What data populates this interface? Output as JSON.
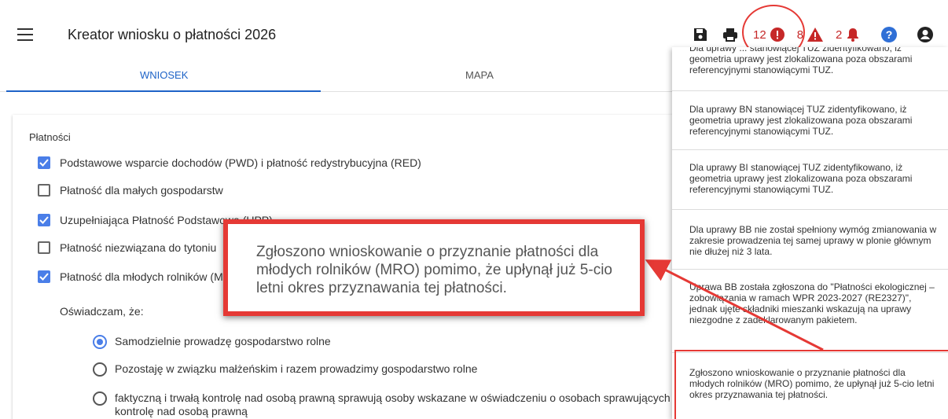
{
  "app": {
    "title": "Kreator wniosku o płatności 2026"
  },
  "toolbar": {
    "errors_count": "12",
    "warnings_count": "8",
    "notifications_count": "2",
    "accent_color": "#c62828"
  },
  "tabs": [
    {
      "label": "WNIOSEK",
      "active": true
    },
    {
      "label": "MAPA",
      "active": false
    }
  ],
  "payments": {
    "section_label": "Płatności",
    "items": [
      {
        "label": "Podstawowe wsparcie dochodów (PWD) i płatność redystrybucyjna (RED)",
        "checked": true
      },
      {
        "label": "Płatność dla małych gospodarstw",
        "checked": false
      },
      {
        "label": "Uzupełniająca Płatność Podstawowa (UPP)",
        "checked": true
      },
      {
        "label": "Płatność niezwiązana do tytoniu",
        "checked": false
      },
      {
        "label": "Płatność dla młodych rolników (MRO)",
        "checked": true
      }
    ],
    "declaration_label": "Oświadczam, że:",
    "radios": [
      {
        "label": "Samodzielnie prowadzę gospodarstwo rolne",
        "checked": true
      },
      {
        "label": "Pozostaję w związku małżeńskim i razem prowadzimy gospodarstwo rolne",
        "checked": false
      },
      {
        "label": "faktyczną i trwałą kontrolę nad osobą prawną sprawują osoby wskazane w oświadczeniu o osobach sprawujących kontrolę nad osobą prawną",
        "checked": false
      }
    ]
  },
  "notifications": [
    {
      "text": "Dla uprawy ... stanowiącej TUZ zidentyfikowano, iż geometria uprawy jest zlokalizowana poza obszarami referencyjnymi stanowiącymi TUZ."
    },
    {
      "text": "Dla uprawy BN stanowiącej TUZ zidentyfikowano, iż geometria uprawy jest zlokalizowana poza obszarami referencyjnymi stanowiącymi TUZ."
    },
    {
      "text": "Dla uprawy BI stanowiącej TUZ zidentyfikowano, iż geometria uprawy jest zlokalizowana poza obszarami referencyjnymi stanowiącymi TUZ."
    },
    {
      "text": "Dla uprawy BB nie został spełniony wymóg zmianowania w zakresie prowadzenia tej samej uprawy w plonie głównym nie dłużej niż 3 lata."
    },
    {
      "text": "Uprawa BB została zgłoszona do \"Płatności ekologicznej – zobowiązania w ramach WPR 2023-2027 (RE2327)\", jednak ujęte składniki mieszanki wskazują na uprawy niezgodne z zadeklarowanym pakietem."
    },
    {
      "text": "Zgłoszono wnioskowanie o przyznanie płatności dla młodych rolników (MRO) pomimo, że upłynął już 5-cio letni okres przyznawania tej płatności."
    }
  ],
  "callout": {
    "text": "Zgłoszono wnioskowanie o przyznanie płatności dla młodych rolników (MRO) pomimo, że upłynął już 5-cio letni okres przyznawania tej płatności."
  }
}
